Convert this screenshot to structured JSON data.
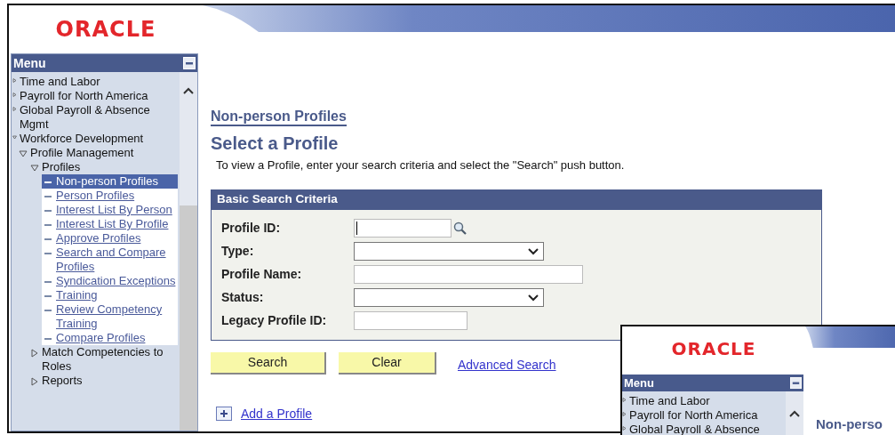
{
  "header": {
    "logo": "ORACLE"
  },
  "menu": {
    "title": "Menu",
    "items": [
      {
        "label": "Time and Labor",
        "kind": "folder",
        "expanded": false
      },
      {
        "label": "Payroll for North America",
        "kind": "folder",
        "expanded": false
      },
      {
        "label": "Global Payroll & Absence Mgmt",
        "kind": "folder",
        "expanded": false
      },
      {
        "label": "Workforce Development",
        "kind": "folder",
        "expanded": true,
        "children": [
          {
            "label": "Profile Management",
            "kind": "folder",
            "expanded": true,
            "children": [
              {
                "label": "Profiles",
                "kind": "folder",
                "expanded": true,
                "children": [
                  {
                    "label": "Non-person Profiles",
                    "kind": "link",
                    "selected": true
                  },
                  {
                    "label": "Person Profiles",
                    "kind": "link",
                    "selected": false
                  },
                  {
                    "label": "Interest List By Person",
                    "kind": "link",
                    "selected": false
                  },
                  {
                    "label": "Interest List By Profile",
                    "kind": "link",
                    "selected": false
                  },
                  {
                    "label": "Approve Profiles",
                    "kind": "link",
                    "selected": false
                  },
                  {
                    "label": "Search and Compare Profiles",
                    "kind": "link",
                    "selected": false
                  },
                  {
                    "label": "Syndication Exceptions",
                    "kind": "link",
                    "selected": false
                  },
                  {
                    "label": "Training",
                    "kind": "link",
                    "selected": false
                  },
                  {
                    "label": "Review Competency Training",
                    "kind": "link",
                    "selected": false
                  },
                  {
                    "label": "Compare Profiles",
                    "kind": "link",
                    "selected": false
                  }
                ]
              },
              {
                "label": "Match Competencies to Roles",
                "kind": "folder",
                "expanded": false
              },
              {
                "label": "Reports",
                "kind": "folder",
                "expanded": false
              }
            ]
          }
        ]
      }
    ]
  },
  "page": {
    "breadcrumb": "Non-person Profiles",
    "title": "Select a Profile",
    "instructions": "To view a Profile, enter your search criteria and select the \"Search\" push button.",
    "search_box": {
      "title": "Basic Search Criteria",
      "fields": [
        {
          "label": "Profile ID:",
          "kind": "lookup"
        },
        {
          "label": "Type:",
          "kind": "select"
        },
        {
          "label": "Profile Name:",
          "kind": "text"
        },
        {
          "label": "Status:",
          "kind": "select"
        },
        {
          "label": "Legacy Profile ID:",
          "kind": "text"
        }
      ]
    },
    "buttons": [
      "Search",
      "Clear"
    ],
    "advanced_link": "Advanced Search",
    "add_link": "Add a Profile"
  },
  "inset": {
    "logo": "ORACLE",
    "menu_title": "Menu",
    "items": [
      "Time and Labor",
      "Payroll for North America",
      "Global Payroll & Absence"
    ],
    "page_title": "Non-perso"
  }
}
